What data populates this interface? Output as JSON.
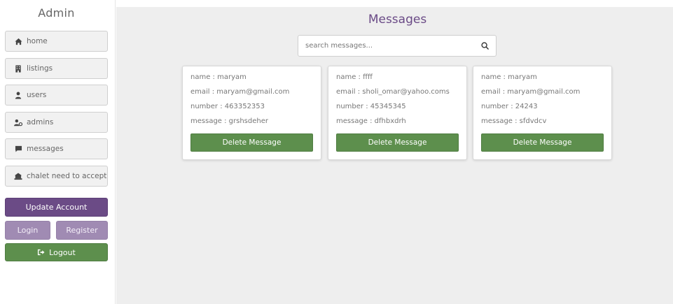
{
  "sidebar": {
    "title": "Admin",
    "nav": [
      {
        "label": "home",
        "icon": "home-icon"
      },
      {
        "label": "listings",
        "icon": "building-icon"
      },
      {
        "label": "users",
        "icon": "user-icon"
      },
      {
        "label": "admins",
        "icon": "user-cog-icon"
      },
      {
        "label": "messages",
        "icon": "comment-icon"
      },
      {
        "label": "chalet need to accept",
        "icon": "laptop-house-icon"
      }
    ],
    "update_label": "Update Account",
    "login_label": "Login",
    "register_label": "Register",
    "logout_label": "Logout"
  },
  "main": {
    "title": "Messages",
    "search_placeholder": "search messages...",
    "messages": [
      {
        "name": "name : maryam",
        "email": "email : maryam@gmail.com",
        "number": "number : 463352353",
        "message": "message : grshsdeher",
        "delete_label": "Delete Message"
      },
      {
        "name": "name : ffff",
        "email": "email : sholi_omar@yahoo.coms",
        "number": "number : 45345345",
        "message": "message : dfhbxdrh",
        "delete_label": "Delete Message"
      },
      {
        "name": "name : maryam",
        "email": "email : maryam@gmail.com",
        "number": "number : 24243",
        "message": "message : sfdvdcv",
        "delete_label": "Delete Message"
      }
    ]
  },
  "colors": {
    "accent_purple": "#6b4b86",
    "light_purple": "#a08bb3",
    "green": "#5d8f4d",
    "background": "#eeeeee"
  }
}
